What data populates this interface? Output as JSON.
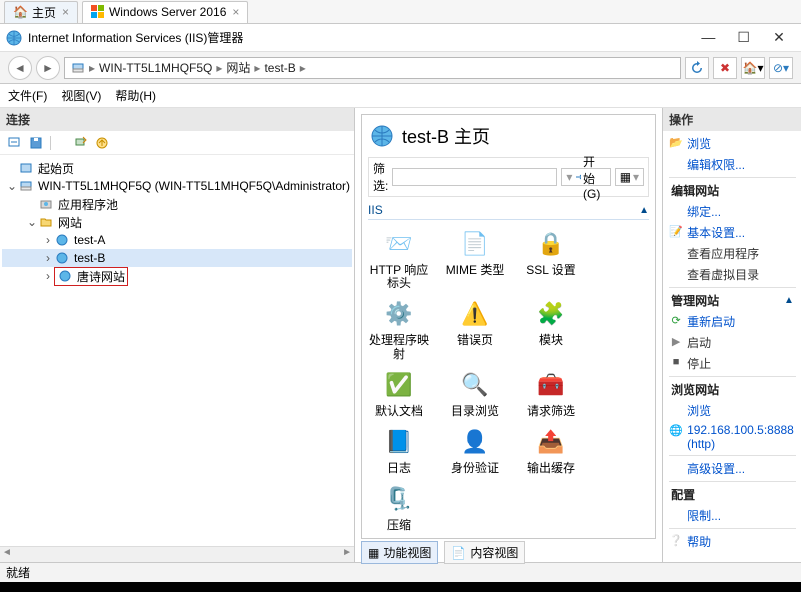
{
  "tabs": {
    "home": "主页",
    "server": "Windows Server 2016"
  },
  "window_title": "Internet Information Services (IIS)管理器",
  "window_controls": {
    "min": "—",
    "max": "☐",
    "close": "✕"
  },
  "breadcrumb": {
    "server": "WIN-TT5L1MHQF5Q",
    "l1": "网站",
    "l2": "test-B",
    "sep": "▸"
  },
  "menus": {
    "file": "文件(F)",
    "view": "视图(V)",
    "help": "帮助(H)"
  },
  "left": {
    "header": "连接",
    "tree": {
      "start": "起始页",
      "server": "WIN-TT5L1MHQF5Q (WIN-TT5L1MHQF5Q\\Administrator)",
      "app_pool": "应用程序池",
      "sites": "网站",
      "site_a": "test-A",
      "site_b": "test-B",
      "site_tang": "唐诗网站"
    }
  },
  "center": {
    "title": "test-B 主页",
    "filter_label": "筛选:",
    "filter_value": "",
    "start_dd": "开始(G)",
    "section": "IIS",
    "icons": [
      "HTTP 响应标头",
      "MIME 类型",
      "SSL 设置",
      "处理程序映射",
      "错误页",
      "模块",
      "默认文档",
      "目录浏览",
      "请求筛选",
      "日志",
      "身份验证",
      "输出缓存",
      "压缩"
    ],
    "view_feature": "功能视图",
    "view_content": "内容视图"
  },
  "right": {
    "header": "操作",
    "explore": "浏览",
    "edit_perm": "编辑权限...",
    "edit_site": "编辑网站",
    "bindings": "绑定...",
    "basic": "基本设置...",
    "view_apps": "查看应用程序",
    "view_vdirs": "查看虚拟目录",
    "manage_site": "管理网站",
    "restart": "重新启动",
    "start": "启动",
    "stop": "停止",
    "browse_site": "浏览网站",
    "browse": "浏览",
    "url": "192.168.100.5:8888 (http)",
    "advanced": "高级设置...",
    "config": "配置",
    "limit": "限制...",
    "help": "帮助"
  },
  "status": "就绪"
}
